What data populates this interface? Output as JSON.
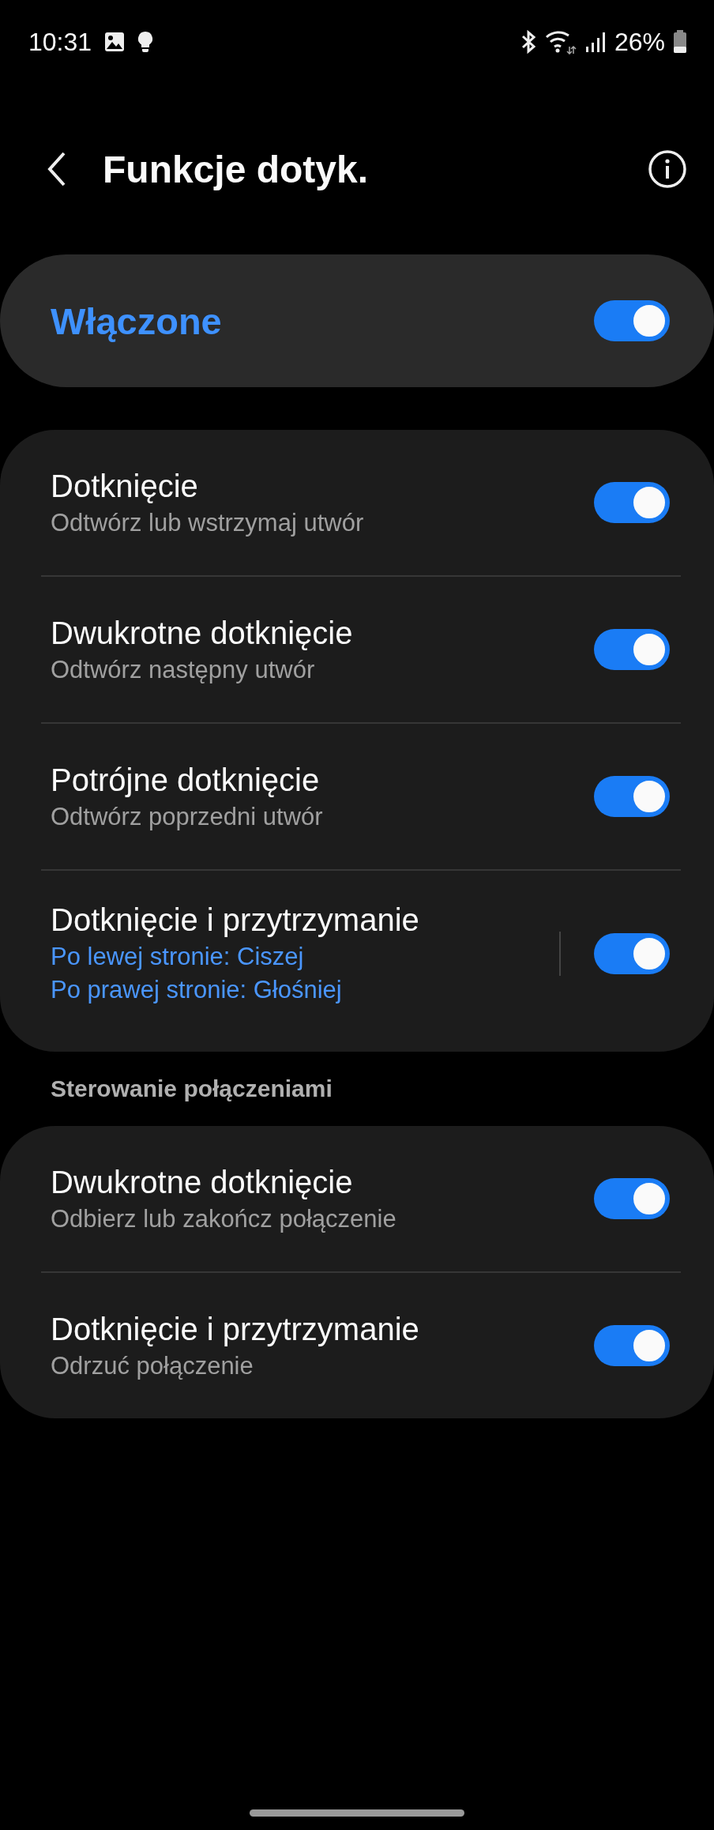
{
  "status_bar": {
    "time": "10:31",
    "battery": "26%"
  },
  "header": {
    "title": "Funkcje dotyk."
  },
  "master": {
    "label": "Włączone",
    "on": true
  },
  "groups": [
    {
      "items": [
        {
          "kind": "standard",
          "title": "Dotknięcie",
          "subtitle": "Odtwórz lub wstrzymaj utwór",
          "on": true
        },
        {
          "kind": "standard",
          "title": "Dwukrotne dotknięcie",
          "subtitle": "Odtwórz następny utwór",
          "on": true
        },
        {
          "kind": "standard",
          "title": "Potrójne dotknięcie",
          "subtitle": "Odtwórz poprzedni utwór",
          "on": true
        },
        {
          "kind": "detail",
          "title": "Dotknięcie i przytrzymanie",
          "details": [
            "Po lewej stronie: Ciszej",
            "Po prawej stronie: Głośniej"
          ],
          "on": true
        }
      ]
    },
    {
      "heading": "Sterowanie połączeniami",
      "items": [
        {
          "kind": "standard",
          "title": "Dwukrotne dotknięcie",
          "subtitle": "Odbierz lub zakończ połączenie",
          "on": true
        },
        {
          "kind": "standard",
          "title": "Dotknięcie i przytrzymanie",
          "subtitle": "Odrzuć połączenie",
          "on": true
        }
      ]
    }
  ]
}
